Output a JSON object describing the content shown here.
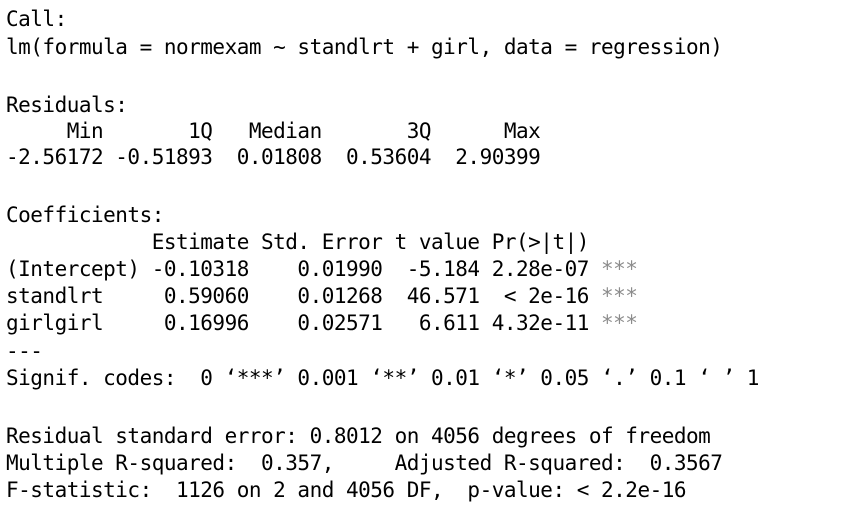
{
  "console": {
    "call_header": "Call:",
    "call": "lm(formula = normexam ~ standlrt + girl, data = regression)",
    "residuals_header": "Residuals:",
    "residuals_labels": "     Min       1Q   Median       3Q      Max ",
    "residuals_values": "-2.56172 -0.51893  0.01808  0.53604  2.90399 ",
    "coefficients_header": "Coefficients:",
    "coef_columns": "            Estimate Std. Error t value Pr(>|t|)    ",
    "coef_rows": [
      {
        "text": "(Intercept) -0.10318    0.01990  -5.184 2.28e-07 ",
        "signif": "***"
      },
      {
        "text": "standlrt     0.59060    0.01268  46.571  < 2e-16 ",
        "signif": "***"
      },
      {
        "text": "girlgirl     0.16996    0.02571   6.611 4.32e-11 ",
        "signif": "***"
      }
    ],
    "separator": "---",
    "signif_codes": "Signif. codes:  0 ‘***’ 0.001 ‘**’ 0.01 ‘*’ 0.05 ‘.’ 0.1 ‘ ’ 1",
    "residual_se": "Residual standard error: 0.8012 on 4056 degrees of freedom",
    "r_squared": "Multiple R-squared:  0.357,\tAdjusted R-squared:  0.3567 ",
    "f_statistic": "F-statistic:  1126 on 2 and 4056 DF,  p-value: < 2.2e-16"
  }
}
